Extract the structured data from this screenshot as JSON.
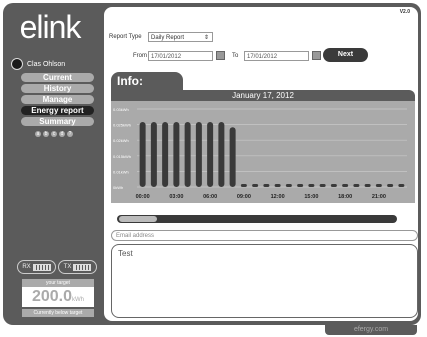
{
  "app": {
    "logo": "elink",
    "version": "V2.0",
    "footer": "efergy.com"
  },
  "user": {
    "name": "Clas Ohlson"
  },
  "nav": [
    {
      "label": "Current",
      "active": false
    },
    {
      "label": "History",
      "active": false
    },
    {
      "label": "Manage",
      "active": false
    },
    {
      "label": "Energy report",
      "active": true
    },
    {
      "label": "Summary",
      "active": false
    }
  ],
  "status_icons": [
    "a",
    "b",
    "c",
    "d",
    "?"
  ],
  "signal": {
    "rx": "RX",
    "tx": "TX"
  },
  "target": {
    "label": "your target",
    "value": "200.0",
    "unit": "kWh",
    "status": "Currently below target"
  },
  "form": {
    "report_type_label": "Report Type",
    "report_type_value": "Daily Report",
    "from_label": "From",
    "from_value": "17/01/2012",
    "to_label": "To",
    "to_value": "17/01/2012",
    "next_label": "Next"
  },
  "info": {
    "title": "Info:",
    "chart_title": "January 17, 2012"
  },
  "email_placeholder": "Email address",
  "message_text": "Test",
  "chart_data": {
    "type": "bar",
    "title": "January 17, 2012",
    "ylabels": [
      "0.03kWh",
      "0.025kWh",
      "0.02kWh",
      "0.015kWh",
      "0.01kWh",
      "0kWh"
    ],
    "ylim": [
      0,
      0.03
    ],
    "xticks": [
      "00:00",
      "03:00",
      "06:00",
      "09:00",
      "12:00",
      "15:00",
      "18:00",
      "21:00"
    ],
    "values": [
      0.025,
      0.025,
      0.025,
      0.025,
      0.025,
      0.025,
      0.025,
      0.025,
      0.023,
      0.0,
      0.0,
      0.0,
      0.0,
      0.0,
      0.0,
      0.0,
      0.0,
      0.0,
      0.0,
      0.0,
      0.0,
      0.0,
      0.0,
      0.0
    ]
  }
}
